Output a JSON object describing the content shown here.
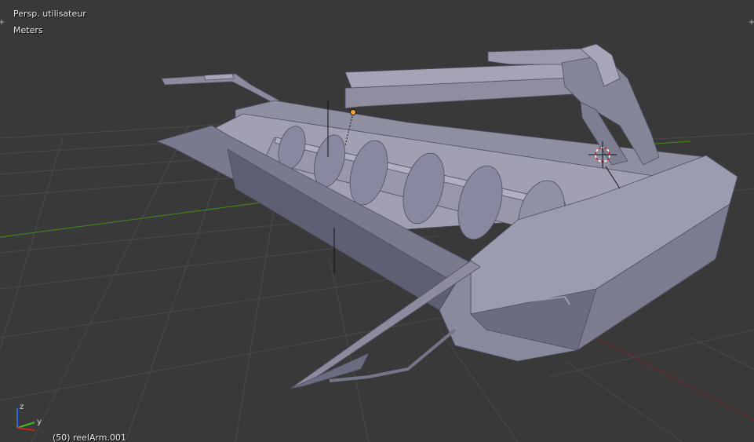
{
  "viewport": {
    "view_name": "Persp. utilisateur",
    "units": "Meters",
    "object_label": "(50) reelArm.001",
    "axis_gizmo": {
      "z_label": "z",
      "y_label": "y"
    },
    "corner_widget_glyph": "+"
  },
  "icons": {
    "scene_cursor": "3d-cursor-icon",
    "corner_widgets": "view-split-plus-icon"
  },
  "colors": {
    "background": "#393939",
    "grid": "#4a4a4a",
    "x_axis": "#8a2a2a",
    "y_axis": "#3f8a1f",
    "model_light": "#a6a6b8",
    "model_mid": "#8c8c9e",
    "model_dark": "#6c6c80",
    "model_shadow": "#55556a",
    "text": "#ececec"
  }
}
